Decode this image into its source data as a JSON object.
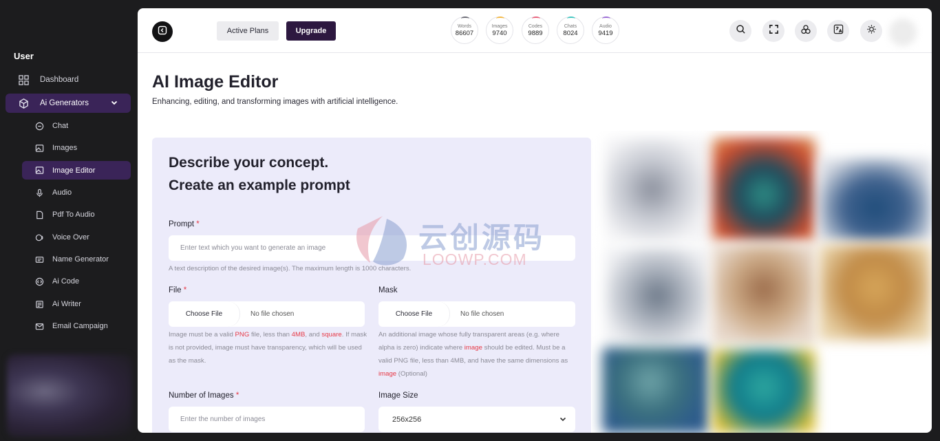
{
  "sidebar": {
    "section": "User",
    "items": [
      {
        "label": "Dashboard",
        "icon": "grid-icon"
      },
      {
        "label": "Ai Generators",
        "icon": "cube-icon",
        "active": true,
        "expanded": true
      }
    ],
    "subitems": [
      {
        "label": "Chat",
        "icon": "chat-icon"
      },
      {
        "label": "Images",
        "icon": "image-icon"
      },
      {
        "label": "Image Editor",
        "icon": "image-edit-icon",
        "active": true
      },
      {
        "label": "Audio",
        "icon": "microphone-icon"
      },
      {
        "label": "Pdf To Audio",
        "icon": "pdf-icon"
      },
      {
        "label": "Voice Over",
        "icon": "voice-icon"
      },
      {
        "label": "Name Generator",
        "icon": "name-icon"
      },
      {
        "label": "Ai Code",
        "icon": "code-icon"
      },
      {
        "label": "Ai Writer",
        "icon": "writer-icon"
      },
      {
        "label": "Email Campaign",
        "icon": "email-icon"
      }
    ]
  },
  "header": {
    "active_plans": "Active Plans",
    "upgrade": "Upgrade",
    "stats": [
      {
        "label": "Words",
        "value": "86607",
        "color": "#6b6b75"
      },
      {
        "label": "Images",
        "value": "9740",
        "color": "#f4b740"
      },
      {
        "label": "Codes",
        "value": "9889",
        "color": "#e8607a"
      },
      {
        "label": "Chats",
        "value": "8024",
        "color": "#3ec6c0"
      },
      {
        "label": "Audio",
        "value": "9419",
        "color": "#9b6bd6"
      }
    ]
  },
  "page": {
    "title": "AI Image Editor",
    "subtitle": "Enhancing, editing, and transforming images with artificial intelligence."
  },
  "form": {
    "heading1": "Describe your concept.",
    "heading2": "Create an example prompt",
    "prompt_label": "Prompt",
    "required_mark": "*",
    "prompt_placeholder": "Enter text which you want to generate an image",
    "prompt_help": "A text description of the desired image(s). The maximum length is 1000 characters.",
    "file_label": "File",
    "choose_file": "Choose File",
    "no_file": "No file chosen",
    "file_help": {
      "p1": "Image must be a valid ",
      "h1": "PNG",
      "p2": " file, less than ",
      "h2": "4MB",
      "p3": ", and ",
      "h3": "square",
      "p4": ". If mask is not provided, image must have transparency, which will be used as the mask."
    },
    "mask_label": "Mask",
    "mask_help": {
      "p1": "An additional image whose fully transparent areas (e.g. where alpha is zero) indicate where ",
      "h1": "image",
      "p2": " should be edited. Must be a valid PNG file, less than 4MB, and have the same dimensions as ",
      "h2": "image",
      "p3": " (Optional)"
    },
    "num_images_label": "Number of Images",
    "num_images_placeholder": "Enter the number of images",
    "image_size_label": "Image Size",
    "image_size_value": "256x256"
  },
  "watermark": {
    "cn": "云创源码",
    "en": "LOOWP.COM"
  }
}
